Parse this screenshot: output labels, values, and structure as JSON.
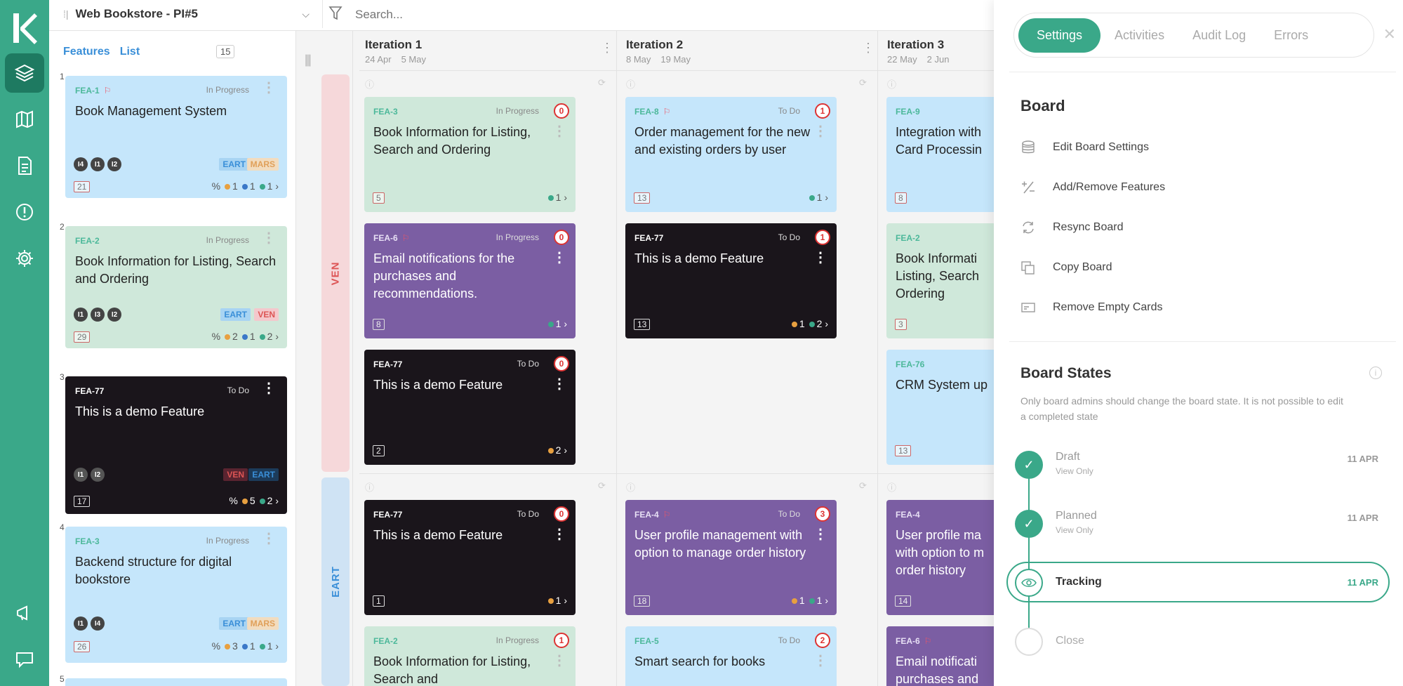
{
  "board": {
    "name": "Web Bookstore - PI#5"
  },
  "search": {
    "placeholder": "Search..."
  },
  "features_panel": {
    "tab_features": "Features",
    "tab_list": "List",
    "count": "15",
    "cards": [
      {
        "index": "1",
        "id": "FEA-1",
        "status": "In Progress",
        "title": "Book Management System",
        "iterations": [
          "I4",
          "I1",
          "I2"
        ],
        "tags": [
          "EART",
          "MARS"
        ],
        "points": "21",
        "dots": [
          "1",
          "1",
          "1"
        ]
      },
      {
        "index": "2",
        "id": "FEA-2",
        "status": "In Progress",
        "title": "Book Information for Listing, Search and Ordering",
        "iterations": [
          "I1",
          "I3",
          "I2"
        ],
        "tags": [
          "EART",
          "VEN"
        ],
        "points": "29",
        "dots": [
          "2",
          "1",
          "2"
        ]
      },
      {
        "index": "3",
        "id": "FEA-77",
        "status": "To Do",
        "title": "This is a demo Feature",
        "iterations": [
          "I1",
          "I2"
        ],
        "tags": [
          "VEN",
          "EART"
        ],
        "points": "17",
        "dots": [
          "5",
          "2"
        ]
      },
      {
        "index": "4",
        "id": "FEA-3",
        "status": "In Progress",
        "title": "Backend structure for digital bookstore",
        "iterations": [
          "I1",
          "I4"
        ],
        "tags": [
          "EART",
          "MARS"
        ],
        "points": "26",
        "dots": [
          "3",
          "1",
          "1"
        ]
      },
      {
        "index": "5"
      }
    ]
  },
  "columns": [
    {
      "title": "Iteration 1",
      "start": "24 Apr",
      "end": "5 May"
    },
    {
      "title": "Iteration 2",
      "start": "8 May",
      "end": "19 May"
    },
    {
      "title": "Iteration 3",
      "start": "22 May",
      "end": "2 Jun"
    }
  ],
  "lanes": [
    "VEN",
    "EART"
  ],
  "board_cards": {
    "c1": {
      "id": "FEA-3",
      "status": "In Progress",
      "title": "Book Information for Listing, Search and Ordering",
      "badge": "0",
      "points": "5",
      "dots": [
        "1"
      ]
    },
    "c2": {
      "id": "FEA-6",
      "status": "In Progress",
      "title": "Email notifications for the purchases and recommendations.",
      "badge": "0",
      "points": "8",
      "dots": [
        "1"
      ]
    },
    "c3": {
      "id": "FEA-77",
      "status": "To Do",
      "title": "This is a demo Feature",
      "badge": "0",
      "points": "2",
      "dots": [
        "2"
      ]
    },
    "c4": {
      "id": "FEA-8",
      "status": "To Do",
      "title": "Order management for the new and existing orders by user",
      "badge": "1",
      "points": "13",
      "dots": [
        "1"
      ]
    },
    "c5": {
      "id": "FEA-77",
      "status": "To Do",
      "title": "This is a demo Feature",
      "badge": "1",
      "points": "13",
      "dots": [
        "1",
        "2"
      ]
    },
    "c6": {
      "id": "FEA-9",
      "title": "Integration with Card Processin",
      "points": "8"
    },
    "c7": {
      "id": "FEA-2",
      "title": "Book Informati Listing, Search Ordering",
      "points": "3"
    },
    "c8": {
      "id": "FEA-76",
      "title": "CRM System up",
      "points": "13"
    },
    "c9": {
      "id": "FEA-77",
      "status": "To Do",
      "title": "This is a demo Feature",
      "badge": "0",
      "points": "1",
      "dots": [
        "1"
      ]
    },
    "c10": {
      "id": "FEA-4",
      "status": "To Do",
      "title": "User profile management with option to manage order history",
      "badge": "3",
      "points": "18",
      "dots": [
        "1",
        "1"
      ]
    },
    "c11": {
      "id": "FEA-4",
      "title": "User profile ma with option to m order history",
      "points": "14"
    },
    "c12": {
      "id": "FEA-2",
      "status": "In Progress",
      "title": "Book Information for Listing, Search and",
      "badge": "1"
    },
    "c13": {
      "id": "FEA-5",
      "status": "To Do",
      "title": "Smart search for books",
      "badge": "2"
    },
    "c14": {
      "id": "FEA-6",
      "title": "Email notificati purchases and"
    }
  },
  "settings": {
    "tabs": [
      "Settings",
      "Activities",
      "Audit Log",
      "Errors"
    ],
    "board_heading": "Board",
    "items": [
      "Edit Board Settings",
      "Add/Remove Features",
      "Resync Board",
      "Copy Board",
      "Remove Empty Cards"
    ],
    "states_heading": "Board States",
    "states_note": "Only board admins should change the board state. It is not possible to edit a completed state",
    "states": [
      {
        "name": "Draft",
        "sub": "View Only",
        "date": "11 APR"
      },
      {
        "name": "Planned",
        "sub": "View Only",
        "date": "11 APR"
      },
      {
        "name": "Tracking",
        "date": "11 APR"
      },
      {
        "name": "Close"
      }
    ]
  },
  "colors": {
    "brand": "#3aa889",
    "blue_card": "#c5e6fb",
    "green_card": "#cfe8da",
    "purple_card": "#7b5ea3",
    "black_card": "#1a151b",
    "dot_orange": "#e8a040",
    "dot_blue": "#3a78c8",
    "dot_green": "#3aa889"
  }
}
